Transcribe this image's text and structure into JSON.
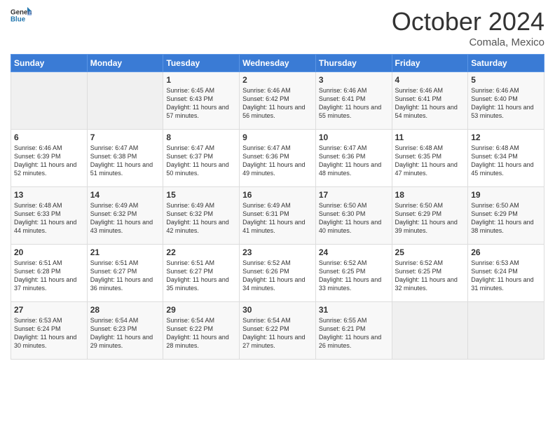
{
  "header": {
    "logo_general": "General",
    "logo_blue": "Blue",
    "month_title": "October 2024",
    "subtitle": "Comala, Mexico"
  },
  "weekdays": [
    "Sunday",
    "Monday",
    "Tuesday",
    "Wednesday",
    "Thursday",
    "Friday",
    "Saturday"
  ],
  "weeks": [
    [
      {
        "day": "",
        "info": ""
      },
      {
        "day": "",
        "info": ""
      },
      {
        "day": "1",
        "info": "Sunrise: 6:45 AM\nSunset: 6:43 PM\nDaylight: 11 hours and 57 minutes."
      },
      {
        "day": "2",
        "info": "Sunrise: 6:46 AM\nSunset: 6:42 PM\nDaylight: 11 hours and 56 minutes."
      },
      {
        "day": "3",
        "info": "Sunrise: 6:46 AM\nSunset: 6:41 PM\nDaylight: 11 hours and 55 minutes."
      },
      {
        "day": "4",
        "info": "Sunrise: 6:46 AM\nSunset: 6:41 PM\nDaylight: 11 hours and 54 minutes."
      },
      {
        "day": "5",
        "info": "Sunrise: 6:46 AM\nSunset: 6:40 PM\nDaylight: 11 hours and 53 minutes."
      }
    ],
    [
      {
        "day": "6",
        "info": "Sunrise: 6:46 AM\nSunset: 6:39 PM\nDaylight: 11 hours and 52 minutes."
      },
      {
        "day": "7",
        "info": "Sunrise: 6:47 AM\nSunset: 6:38 PM\nDaylight: 11 hours and 51 minutes."
      },
      {
        "day": "8",
        "info": "Sunrise: 6:47 AM\nSunset: 6:37 PM\nDaylight: 11 hours and 50 minutes."
      },
      {
        "day": "9",
        "info": "Sunrise: 6:47 AM\nSunset: 6:36 PM\nDaylight: 11 hours and 49 minutes."
      },
      {
        "day": "10",
        "info": "Sunrise: 6:47 AM\nSunset: 6:36 PM\nDaylight: 11 hours and 48 minutes."
      },
      {
        "day": "11",
        "info": "Sunrise: 6:48 AM\nSunset: 6:35 PM\nDaylight: 11 hours and 47 minutes."
      },
      {
        "day": "12",
        "info": "Sunrise: 6:48 AM\nSunset: 6:34 PM\nDaylight: 11 hours and 45 minutes."
      }
    ],
    [
      {
        "day": "13",
        "info": "Sunrise: 6:48 AM\nSunset: 6:33 PM\nDaylight: 11 hours and 44 minutes."
      },
      {
        "day": "14",
        "info": "Sunrise: 6:49 AM\nSunset: 6:32 PM\nDaylight: 11 hours and 43 minutes."
      },
      {
        "day": "15",
        "info": "Sunrise: 6:49 AM\nSunset: 6:32 PM\nDaylight: 11 hours and 42 minutes."
      },
      {
        "day": "16",
        "info": "Sunrise: 6:49 AM\nSunset: 6:31 PM\nDaylight: 11 hours and 41 minutes."
      },
      {
        "day": "17",
        "info": "Sunrise: 6:50 AM\nSunset: 6:30 PM\nDaylight: 11 hours and 40 minutes."
      },
      {
        "day": "18",
        "info": "Sunrise: 6:50 AM\nSunset: 6:29 PM\nDaylight: 11 hours and 39 minutes."
      },
      {
        "day": "19",
        "info": "Sunrise: 6:50 AM\nSunset: 6:29 PM\nDaylight: 11 hours and 38 minutes."
      }
    ],
    [
      {
        "day": "20",
        "info": "Sunrise: 6:51 AM\nSunset: 6:28 PM\nDaylight: 11 hours and 37 minutes."
      },
      {
        "day": "21",
        "info": "Sunrise: 6:51 AM\nSunset: 6:27 PM\nDaylight: 11 hours and 36 minutes."
      },
      {
        "day": "22",
        "info": "Sunrise: 6:51 AM\nSunset: 6:27 PM\nDaylight: 11 hours and 35 minutes."
      },
      {
        "day": "23",
        "info": "Sunrise: 6:52 AM\nSunset: 6:26 PM\nDaylight: 11 hours and 34 minutes."
      },
      {
        "day": "24",
        "info": "Sunrise: 6:52 AM\nSunset: 6:25 PM\nDaylight: 11 hours and 33 minutes."
      },
      {
        "day": "25",
        "info": "Sunrise: 6:52 AM\nSunset: 6:25 PM\nDaylight: 11 hours and 32 minutes."
      },
      {
        "day": "26",
        "info": "Sunrise: 6:53 AM\nSunset: 6:24 PM\nDaylight: 11 hours and 31 minutes."
      }
    ],
    [
      {
        "day": "27",
        "info": "Sunrise: 6:53 AM\nSunset: 6:24 PM\nDaylight: 11 hours and 30 minutes."
      },
      {
        "day": "28",
        "info": "Sunrise: 6:54 AM\nSunset: 6:23 PM\nDaylight: 11 hours and 29 minutes."
      },
      {
        "day": "29",
        "info": "Sunrise: 6:54 AM\nSunset: 6:22 PM\nDaylight: 11 hours and 28 minutes."
      },
      {
        "day": "30",
        "info": "Sunrise: 6:54 AM\nSunset: 6:22 PM\nDaylight: 11 hours and 27 minutes."
      },
      {
        "day": "31",
        "info": "Sunrise: 6:55 AM\nSunset: 6:21 PM\nDaylight: 11 hours and 26 minutes."
      },
      {
        "day": "",
        "info": ""
      },
      {
        "day": "",
        "info": ""
      }
    ]
  ]
}
